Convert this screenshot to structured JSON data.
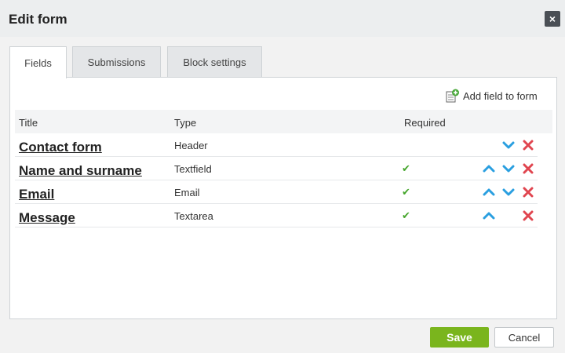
{
  "dialog": {
    "title": "Edit form",
    "close_label": "×"
  },
  "tabs": [
    {
      "label": "Fields"
    },
    {
      "label": "Submissions"
    },
    {
      "label": "Block settings"
    }
  ],
  "toolbar": {
    "add_field_label": "Add field to form"
  },
  "table": {
    "headers": {
      "title": "Title",
      "type": "Type",
      "required": "Required"
    },
    "rows": [
      {
        "title": "Contact form",
        "type": "Header",
        "required": false,
        "required_mark": "",
        "can_up": false,
        "can_down": true,
        "can_delete": true
      },
      {
        "title": "Name and surname",
        "type": "Textfield",
        "required": true,
        "required_mark": "✔",
        "can_up": true,
        "can_down": true,
        "can_delete": true
      },
      {
        "title": "Email",
        "type": "Email",
        "required": true,
        "required_mark": "✔",
        "can_up": true,
        "can_down": true,
        "can_delete": true
      },
      {
        "title": "Message",
        "type": "Textarea",
        "required": true,
        "required_mark": "✔",
        "can_up": true,
        "can_down": false,
        "can_delete": true
      }
    ]
  },
  "footer": {
    "save_label": "Save",
    "cancel_label": "Cancel"
  },
  "colors": {
    "save_green": "#7ab51d",
    "arrow_blue": "#2a9fe0",
    "delete_red": "#e0454f",
    "check_green": "#44a52b"
  }
}
